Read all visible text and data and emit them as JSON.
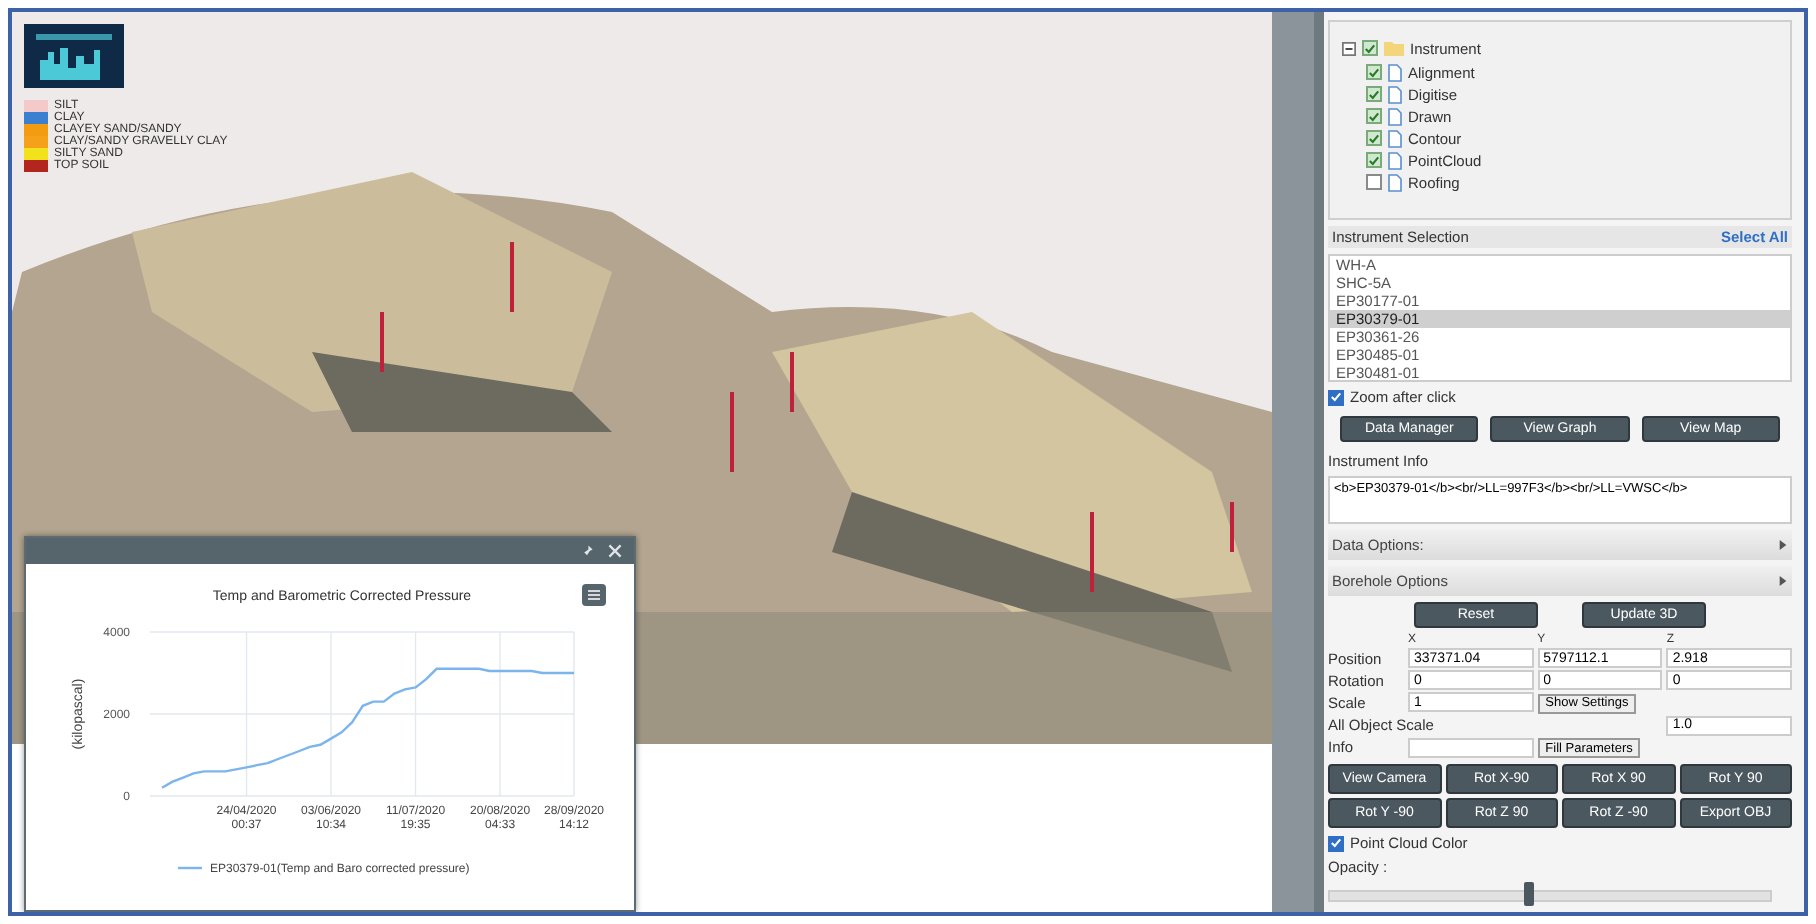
{
  "legend": [
    {
      "label": "SILT",
      "color": "#f4c9c9"
    },
    {
      "label": "CLAY",
      "color": "#3b7fd0"
    },
    {
      "label": "CLAYEY SAND/SANDY",
      "color": "#f39c12"
    },
    {
      "label": "CLAY/SANDY GRAVELLY CLAY",
      "color": "#f5a11a"
    },
    {
      "label": "SILTY SAND",
      "color": "#f1e21b"
    },
    {
      "label": "TOP SOIL",
      "color": "#b3261e"
    }
  ],
  "chart_window": {
    "chart_data": {
      "type": "line",
      "title": "Temp and Barometric Corrected Pressure",
      "ylabel": "(kilopascal)",
      "categories": [
        null,
        null,
        null,
        null,
        null,
        null,
        null,
        null,
        "24/04/2020 00:37",
        null,
        null,
        null,
        null,
        null,
        null,
        null,
        "03/06/2020 10:34",
        null,
        null,
        null,
        null,
        null,
        null,
        null,
        "11/07/2020 19:35",
        null,
        null,
        null,
        null,
        null,
        null,
        null,
        "20/08/2020 04:33",
        null,
        null,
        null,
        null,
        null,
        null,
        "28/09/2020 14:12"
      ],
      "series": [
        {
          "name": "EP30379-01(Temp and Baro corrected pressure)",
          "color": "#7cb5ec",
          "values": [
            200,
            350,
            450,
            550,
            600,
            600,
            600,
            650,
            700,
            750,
            800,
            900,
            1000,
            1100,
            1200,
            1250,
            1400,
            1550,
            1800,
            2200,
            2300,
            2300,
            2500,
            2600,
            2650,
            2850,
            3100,
            3100,
            3100,
            3100,
            3100,
            3050,
            3050,
            3050,
            3050,
            3050,
            3000,
            3000,
            3000,
            3000
          ]
        }
      ],
      "ylim": [
        0,
        4000
      ],
      "yticks": [
        0,
        2000,
        4000
      ],
      "grid": true
    }
  },
  "layer_tree": {
    "label": "Instrument",
    "checked": true,
    "expanded": true,
    "children": [
      {
        "label": "Alignment",
        "checked": true
      },
      {
        "label": "Digitise",
        "checked": true
      },
      {
        "label": "Drawn",
        "checked": true
      },
      {
        "label": "Contour",
        "checked": true
      },
      {
        "label": "PointCloud",
        "checked": true
      },
      {
        "label": "Roofing",
        "checked": false
      }
    ]
  },
  "instrument_selection": {
    "title": "Instrument Selection",
    "select_all": "Select All",
    "items": [
      {
        "label": "WH-A",
        "selected": false
      },
      {
        "label": "SHC-5A",
        "selected": false
      },
      {
        "label": "EP30177-01",
        "selected": false
      },
      {
        "label": "EP30379-01",
        "selected": true
      },
      {
        "label": "EP30361-26",
        "selected": false
      },
      {
        "label": "EP30485-01",
        "selected": false
      },
      {
        "label": "EP30481-01",
        "selected": false
      }
    ]
  },
  "zoom_after_click": {
    "label": "Zoom after click",
    "checked": true
  },
  "action_buttons": [
    "Data Manager",
    "View Graph",
    "View Map"
  ],
  "instrument_info": {
    "label": "Instrument Info",
    "value": "<b>EP30379-01</b><br/>LL=997F3</b><br/>LL=VWSC</b>"
  },
  "sections": [
    {
      "label": "Data Options:",
      "expanded": false
    },
    {
      "label": "Borehole Options",
      "expanded": false
    }
  ],
  "borehole": {
    "buttons": [
      "Reset",
      "Update 3D"
    ],
    "axes": [
      "X",
      "Y",
      "Z"
    ],
    "rows": [
      {
        "kind": "triple",
        "label": "Position",
        "values": [
          "337371.04",
          "5797112.1",
          "2.918"
        ]
      },
      {
        "kind": "triple",
        "label": "Rotation",
        "values": [
          "0",
          "0",
          "0"
        ]
      },
      {
        "kind": "button",
        "label": "Scale",
        "value": "1",
        "button": "Show Settings"
      },
      {
        "kind": "single",
        "label": "All Object Scale",
        "value": "1.0"
      },
      {
        "kind": "button",
        "label": "Info",
        "button": "Fill Parameters"
      }
    ]
  },
  "view_buttons": [
    "View Camera",
    "Rot X-90",
    "Rot X 90",
    "Rot Y 90",
    "Rot Y -90",
    "Rot Z 90",
    "Rot Z -90",
    "Export OBJ"
  ],
  "point_cloud_color": {
    "label": "Point Cloud Color",
    "checked": true
  },
  "opacity": {
    "label": "Opacity :",
    "level": 0.45
  }
}
